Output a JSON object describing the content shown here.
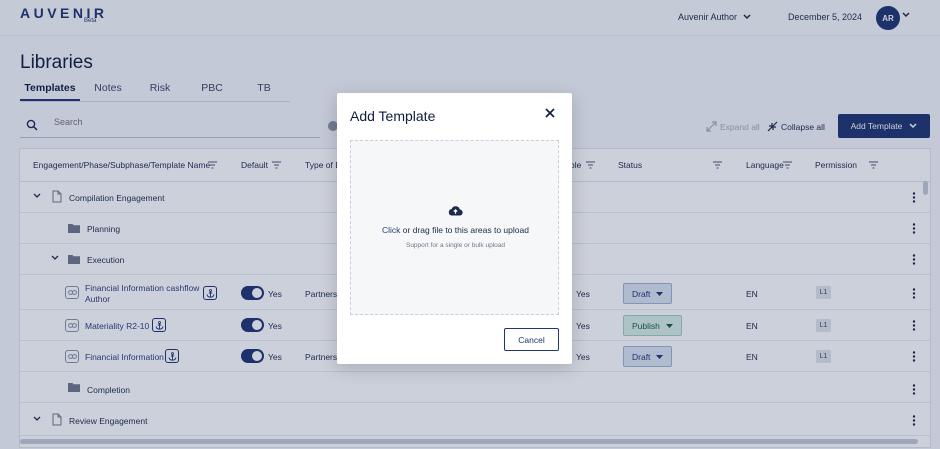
{
  "header": {
    "logo_text": "AUVENIR",
    "logo_tag": "Beta",
    "user_name": "Auvenir Author",
    "date": "December 5, 2024",
    "avatar_initials": "AR"
  },
  "page": {
    "title": "Libraries",
    "tabs": [
      {
        "label": "Templates",
        "active": true
      },
      {
        "label": "Notes",
        "active": false
      },
      {
        "label": "Risk",
        "active": false
      },
      {
        "label": "PBC",
        "active": false
      },
      {
        "label": "TB",
        "active": false
      }
    ],
    "search_placeholder": "Search",
    "expand_all": "Expand all",
    "collapse_all": "Collapse all",
    "add_template": "Add Template"
  },
  "table": {
    "columns": {
      "name": "Engagement/Phase/Subphase/Template Name",
      "default": "Default",
      "type": "Type of B",
      "applicable": "ble",
      "status": "Status",
      "language": "Language",
      "permission": "Permission"
    },
    "rows": [
      {
        "kind": "engagement",
        "name": "Compilation Engagement"
      },
      {
        "kind": "phase",
        "name": "Planning"
      },
      {
        "kind": "phase-open",
        "name": "Execution"
      },
      {
        "kind": "template",
        "name_line1": "Financial Information cashflow",
        "name_line2": "Author",
        "default": "Yes",
        "type": "Partnersh",
        "applicable": "Yes",
        "status": "Draft",
        "language": "EN",
        "permission": "L1"
      },
      {
        "kind": "template",
        "name_line1": "Materiality R2-10",
        "name_line2": "",
        "default": "Yes",
        "type": "",
        "applicable": "Yes",
        "status": "Publish",
        "language": "EN",
        "permission": "L1"
      },
      {
        "kind": "template",
        "name_line1": "Financial Information",
        "name_line2": "",
        "default": "Yes",
        "type": "Partnersh",
        "applicable": "Yes",
        "status": "Draft",
        "language": "EN",
        "permission": "L1"
      },
      {
        "kind": "phase",
        "name": "Completion"
      },
      {
        "kind": "engagement",
        "name": "Review Engagement"
      }
    ]
  },
  "modal": {
    "title": "Add Template",
    "upload_click": "Click",
    "upload_text": " or drag file to this areas to upload",
    "upload_hint": "Support for a single or bulk upload",
    "cancel": "Cancel"
  },
  "colors": {
    "primary": "#1f3470",
    "draft_bg": "#dbe5f2",
    "publish_bg": "#d9efe6"
  }
}
